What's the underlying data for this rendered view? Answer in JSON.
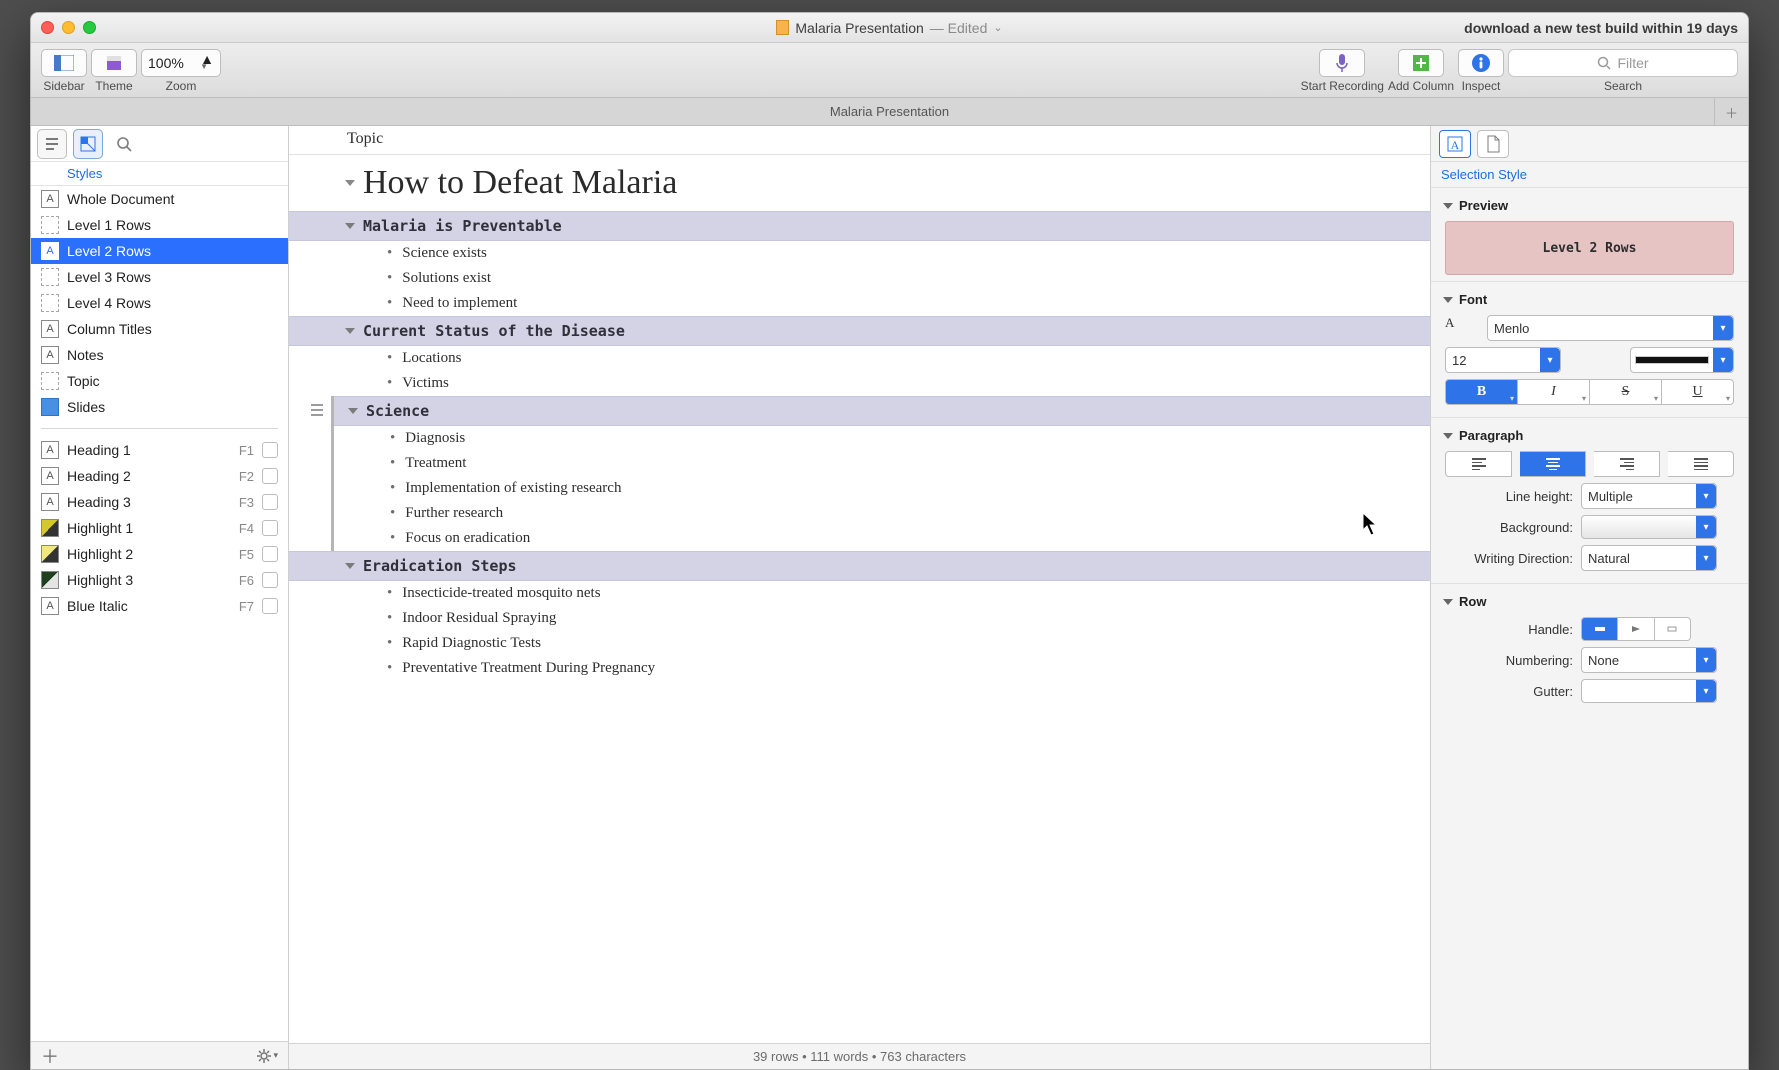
{
  "title": {
    "name": "Malaria Presentation",
    "status": "— Edited"
  },
  "titlebar_note": "download a new test build within 19 days",
  "toolbar": {
    "sidebar": "Sidebar",
    "theme": "Theme",
    "zoom": "Zoom",
    "zoom_value": "100%",
    "record": "Start Recording",
    "add_column": "Add Column",
    "inspect": "Inspect",
    "search": "Search",
    "filter_ph": "Filter"
  },
  "tab": "Malaria Presentation",
  "sidebar": {
    "mode_label": "Styles",
    "styleItems": [
      {
        "name": "Whole Document",
        "icon": "A"
      },
      {
        "name": "Level 1 Rows",
        "icon": "dash"
      },
      {
        "name": "Level 2 Rows",
        "icon": "A",
        "selected": true
      },
      {
        "name": "Level 3 Rows",
        "icon": "dash"
      },
      {
        "name": "Level 4 Rows",
        "icon": "dash"
      },
      {
        "name": "Column Titles",
        "icon": "A"
      },
      {
        "name": "Notes",
        "icon": "A"
      },
      {
        "name": "Topic",
        "icon": "dash"
      },
      {
        "name": "Slides",
        "icon": "blue"
      }
    ],
    "namedStyles": [
      {
        "name": "Heading 1",
        "fkey": "F1",
        "icon": "A"
      },
      {
        "name": "Heading 2",
        "fkey": "F2",
        "icon": "A"
      },
      {
        "name": "Heading 3",
        "fkey": "F3",
        "icon": "A"
      },
      {
        "name": "Highlight 1",
        "fkey": "F4",
        "icon": "hl1"
      },
      {
        "name": "Highlight 2",
        "fkey": "F5",
        "icon": "hl2"
      },
      {
        "name": "Highlight 3",
        "fkey": "F6",
        "icon": "hl3"
      },
      {
        "name": "Blue Italic",
        "fkey": "F7",
        "icon": "A"
      }
    ]
  },
  "outline": {
    "column_header": "Topic",
    "title": "How to Defeat Malaria",
    "sections": [
      {
        "title": "Malaria is Preventable",
        "items": [
          "Science exists",
          "Solutions exist",
          "Need to implement"
        ]
      },
      {
        "title": "Current Status of the Disease",
        "items": [
          "Locations",
          "Victims"
        ]
      },
      {
        "title": "Science",
        "selected": true,
        "items": [
          "Diagnosis",
          "Treatment",
          "Implementation of existing research",
          "Further research",
          "Focus on eradication"
        ]
      },
      {
        "title": "Eradication Steps",
        "items": [
          "Insecticide-treated mosquito nets",
          "Indoor Residual Spraying",
          "Rapid Diagnostic Tests",
          "Preventative Treatment During Pregnancy"
        ]
      }
    ],
    "status": "39 rows  •  111 words  •  763 characters"
  },
  "inspector": {
    "tab_label": "Selection Style",
    "preview_h": "Preview",
    "preview_text": "Level 2 Rows",
    "font_h": "Font",
    "font_family": "Menlo",
    "font_size": "12",
    "para_h": "Paragraph",
    "lh_label": "Line height:",
    "lh_value": "Multiple",
    "bg_label": "Background:",
    "wd_label": "Writing Direction:",
    "wd_value": "Natural",
    "row_h": "Row",
    "handle_label": "Handle:",
    "numbering_label": "Numbering:",
    "numbering_value": "None",
    "gutter_label": "Gutter:"
  }
}
